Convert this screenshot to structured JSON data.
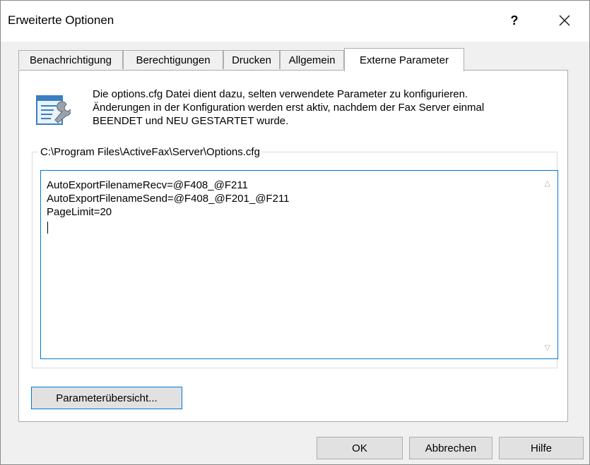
{
  "window": {
    "title": "Erweiterte Optionen",
    "help_label": "?"
  },
  "tabs": [
    {
      "label": "Benachrichtigung"
    },
    {
      "label": "Berechtigungen"
    },
    {
      "label": "Drucken"
    },
    {
      "label": "Allgemein"
    },
    {
      "label": "Externe Parameter"
    }
  ],
  "info": {
    "lines": [
      "Die options.cfg Datei dient dazu, selten verwendete Parameter zu konfigurieren.",
      "Änderungen in der Konfiguration werden erst aktiv, nachdem der Fax Server einmal",
      "BEENDET und NEU GESTARTET wurde."
    ],
    "icon": "settings-file-icon"
  },
  "config": {
    "group_label": "C:\\Program Files\\ActiveFax\\Server\\Options.cfg",
    "lines": [
      "AutoExportFilenameRecv=@F408_@F211",
      "AutoExportFilenameSend=@F408_@F201_@F211",
      "PageLimit=20"
    ]
  },
  "buttons": {
    "param_overview": "Parameterübersicht...",
    "ok": "OK",
    "cancel": "Abbrechen",
    "help": "Hilfe"
  }
}
